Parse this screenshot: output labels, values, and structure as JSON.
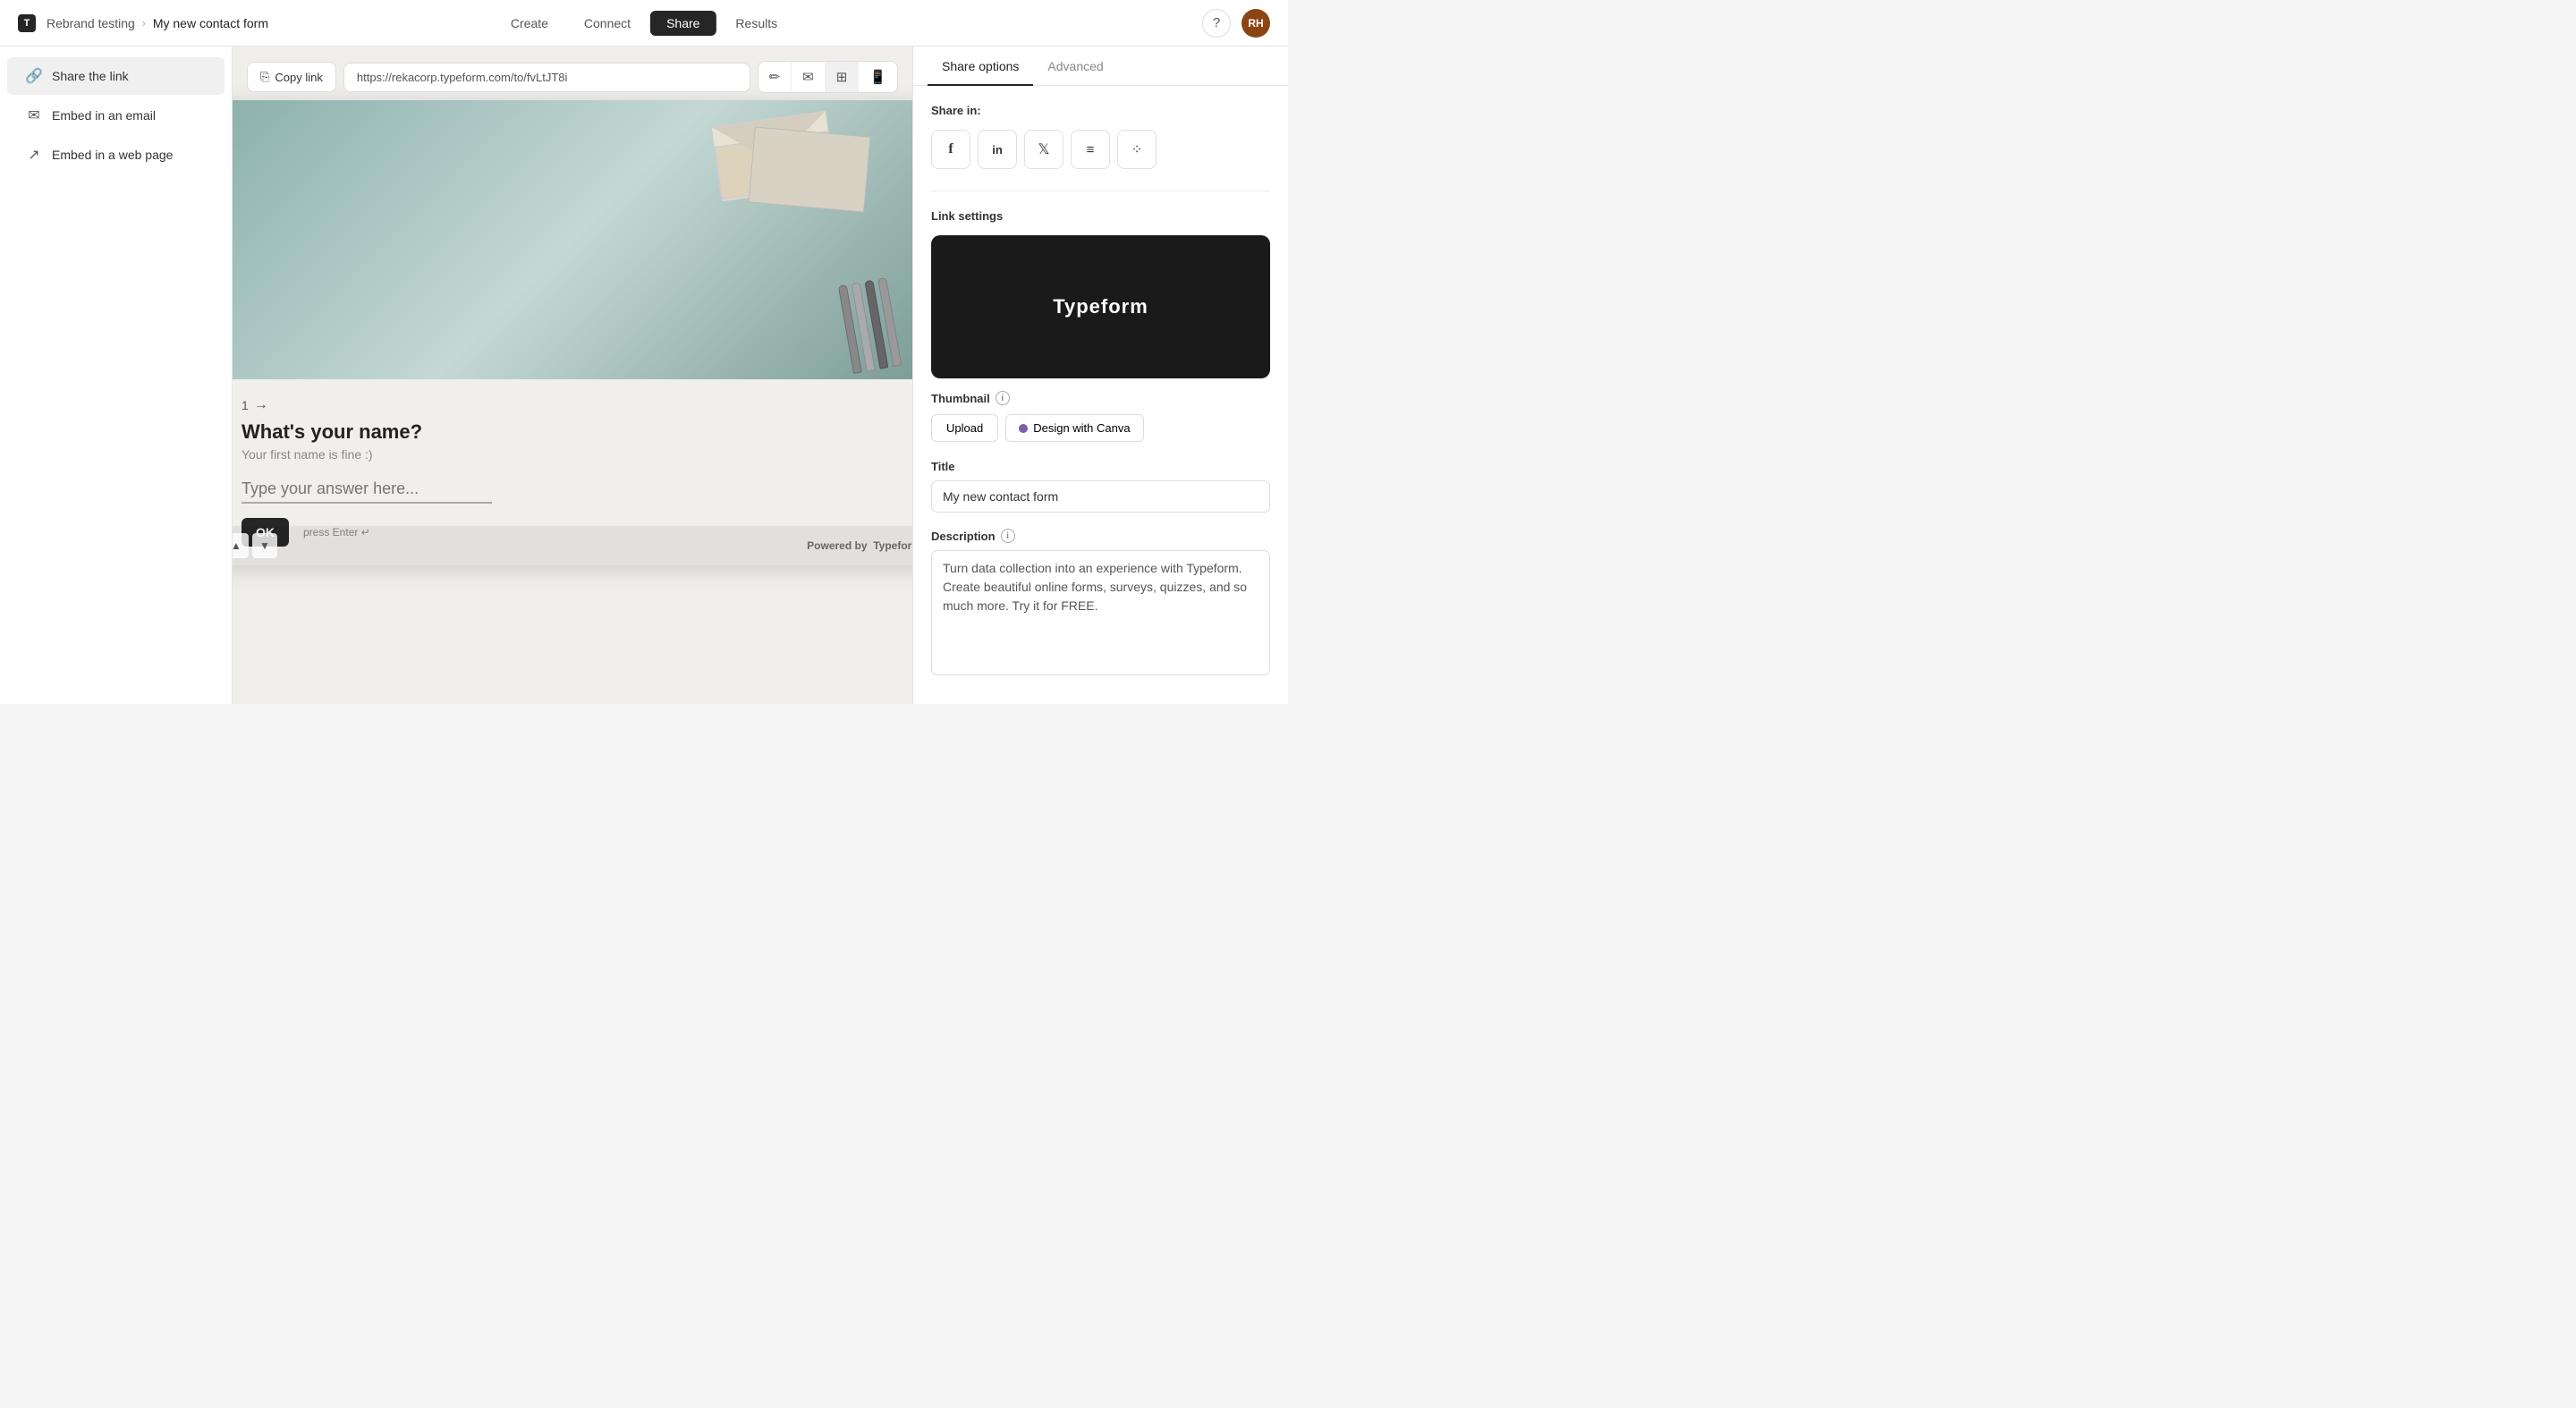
{
  "app": {
    "logo_text": "T",
    "brand_name": "Rebrand testing",
    "breadcrumb_separator": "›",
    "form_name": "My new contact form"
  },
  "nav": {
    "tabs": [
      {
        "id": "create",
        "label": "Create"
      },
      {
        "id": "connect",
        "label": "Connect"
      },
      {
        "id": "share",
        "label": "Share"
      },
      {
        "id": "results",
        "label": "Results"
      }
    ],
    "active_tab": "share",
    "help_icon": "?",
    "avatar_initials": "RH"
  },
  "sidebar": {
    "items": [
      {
        "id": "share-link",
        "label": "Share the link",
        "icon": "🔗",
        "active": true
      },
      {
        "id": "embed-email",
        "label": "Embed in an email",
        "icon": "✉️",
        "active": false
      },
      {
        "id": "embed-web",
        "label": "Embed in a web page",
        "icon": "↗",
        "active": false
      }
    ]
  },
  "url_bar": {
    "copy_link_label": "Copy link",
    "url_value": "https://rekacorp.typeform.com/to/fvLtJT8i"
  },
  "form_preview": {
    "question_number": "1",
    "question_text": "What's your name?",
    "question_hint": "Your first name is fine :)",
    "answer_placeholder": "Type your answer here...",
    "ok_button": "OK",
    "press_enter": "press Enter ↵",
    "powered_by": "Powered by",
    "powered_by_brand": "Typeform"
  },
  "right_panel": {
    "tabs": [
      {
        "id": "share-options",
        "label": "Share options",
        "active": true
      },
      {
        "id": "advanced",
        "label": "Advanced",
        "active": false
      }
    ],
    "share_in_label": "Share in:",
    "social_buttons": [
      {
        "id": "facebook",
        "icon": "f",
        "label": "Facebook"
      },
      {
        "id": "linkedin",
        "icon": "in",
        "label": "LinkedIn"
      },
      {
        "id": "twitter",
        "icon": "𝕏",
        "label": "Twitter/X"
      },
      {
        "id": "buffer",
        "icon": "≡",
        "label": "Buffer"
      },
      {
        "id": "more",
        "icon": "⁘",
        "label": "More"
      }
    ],
    "link_settings_label": "Link settings",
    "thumbnail_text": "Typeform",
    "thumbnail_section_label": "Thumbnail",
    "upload_label": "Upload",
    "canva_label": "Design with Canva",
    "title_label": "Title",
    "title_value": "My new contact form",
    "description_label": "Description",
    "description_value": "Turn data collection into an experience with Typeform. Create beautiful online forms, surveys, quizzes, and so much more. Try it for FREE."
  },
  "pens": [
    {
      "color": "#888"
    },
    {
      "color": "#aaa"
    },
    {
      "color": "#555"
    },
    {
      "color": "#777"
    }
  ]
}
